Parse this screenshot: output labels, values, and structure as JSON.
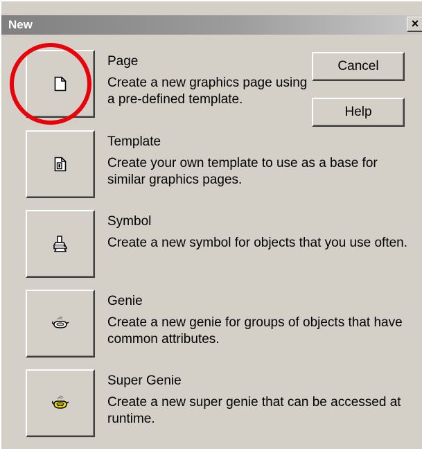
{
  "window": {
    "title": "New",
    "close_glyph": "×"
  },
  "buttons": {
    "cancel_label": "Cancel",
    "help_label": "Help"
  },
  "items": [
    {
      "title": "Page",
      "description": "Create a new graphics page using a pre-defined template.",
      "icon": "page-icon"
    },
    {
      "title": "Template",
      "description": "Create your own template to use as a base for similar graphics pages.",
      "icon": "template-icon"
    },
    {
      "title": "Symbol",
      "description": "Create a new symbol for objects that you use often.",
      "icon": "symbol-icon"
    },
    {
      "title": "Genie",
      "description": "Create a new genie for groups of objects that have common attributes.",
      "icon": "genie-icon"
    },
    {
      "title": "Super Genie",
      "description": "Create a new super genie that can be accessed at runtime.",
      "icon": "super-genie-icon"
    }
  ],
  "colors": {
    "dialog_face": "#d4d0c8",
    "annotation_circle": "#e8000b"
  }
}
